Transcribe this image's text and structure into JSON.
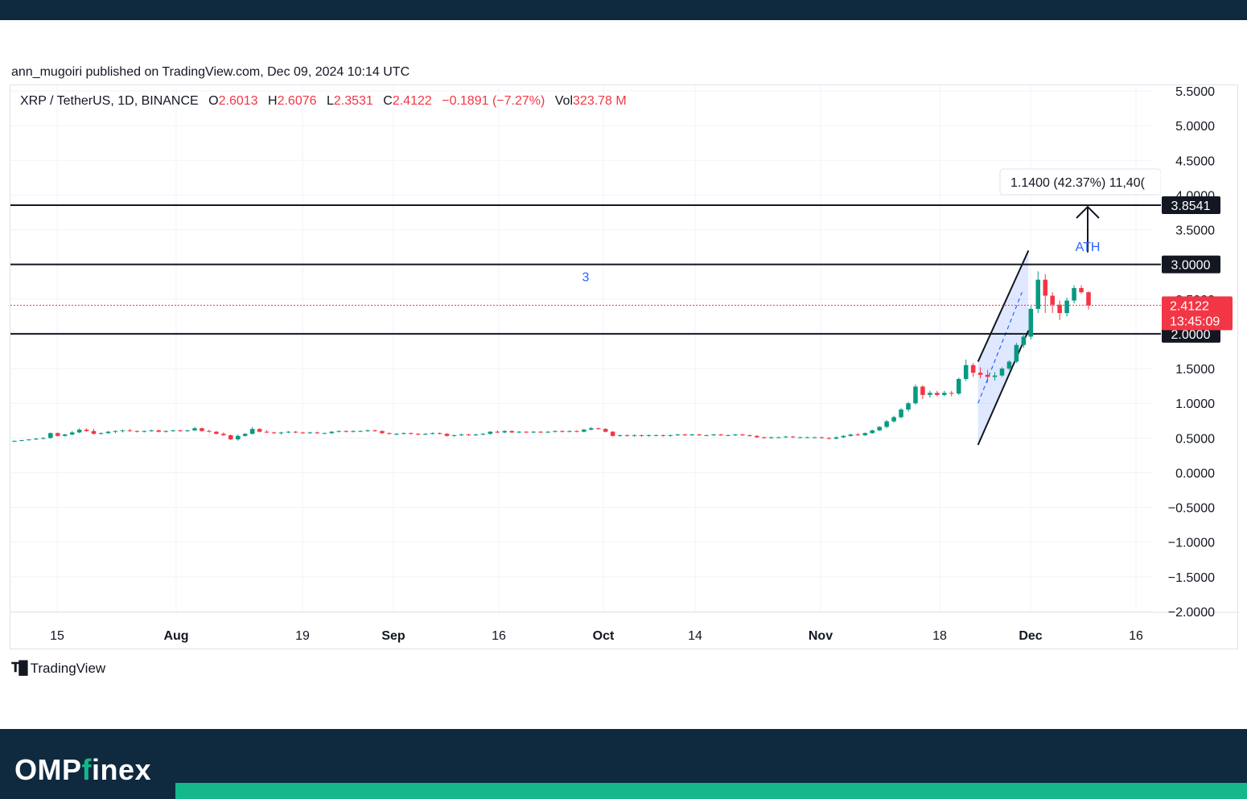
{
  "publisher": "ann_mugoiri published on TradingView.com, Dec 09, 2024 10:14 UTC",
  "legend": {
    "symbol": "XRP / TetherUS, 1D, BINANCE",
    "o_label": "O",
    "o": "2.6013",
    "h_label": "H",
    "h": "2.6076",
    "l_label": "L",
    "l": "2.3531",
    "c_label": "C",
    "c": "2.4122",
    "change": "−0.1891 (−7.27%)",
    "vol_label": "Vol",
    "vol": "323.78 M"
  },
  "branding": {
    "tv": "TradingView",
    "footer_brand_a": "OMP",
    "footer_brand_b": "f",
    "footer_brand_c": "inex"
  },
  "colors": {
    "up": "#089981",
    "down": "#f23645",
    "annotation": "#2962ff",
    "footer_bg": "#0f2a3f",
    "footer_accent": "#14b88a"
  },
  "chart_data": {
    "type": "candlestick",
    "x_ticks": [
      "15",
      "Aug",
      "19",
      "Sep",
      "16",
      "Oct",
      "14",
      "Nov",
      "18",
      "Dec",
      "16"
    ],
    "y_ticks": [
      "5.5000",
      "5.0000",
      "4.5000",
      "4.0000",
      "3.5000",
      "3.0000",
      "2.5000",
      "2.0000",
      "1.5000",
      "1.0000",
      "0.5000",
      "0.0000",
      "−0.5000",
      "−1.0000",
      "−1.5000",
      "−2.0000"
    ],
    "ylim": [
      -2.3,
      5.6
    ],
    "horizontal_levels": [
      {
        "value": 3.8541,
        "label": "3.8541"
      },
      {
        "value": 3.0,
        "label": "3.0000"
      },
      {
        "value": 2.0,
        "label": "2.0000"
      }
    ],
    "last_price": {
      "value": 2.4122,
      "label": "2.4122",
      "countdown": "13:45:09"
    },
    "measure": {
      "text": "1.1400 (42.37%) 11,40(",
      "from": 2.71,
      "to": 3.8541
    },
    "annotations": [
      {
        "text": "ATH",
        "price": 3.26
      },
      {
        "text": "3",
        "price": 2.83
      }
    ],
    "channel": {
      "lower": [
        0.4,
        2.05
      ],
      "upper": [
        1.6,
        3.2
      ]
    },
    "candles": [
      [
        0.45,
        0.46,
        0.44,
        0.46
      ],
      [
        0.46,
        0.47,
        0.45,
        0.47
      ],
      [
        0.47,
        0.48,
        0.46,
        0.48
      ],
      [
        0.48,
        0.5,
        0.47,
        0.49
      ],
      [
        0.49,
        0.51,
        0.48,
        0.5
      ],
      [
        0.5,
        0.58,
        0.49,
        0.57
      ],
      [
        0.57,
        0.58,
        0.52,
        0.53
      ],
      [
        0.53,
        0.56,
        0.52,
        0.55
      ],
      [
        0.55,
        0.6,
        0.54,
        0.58
      ],
      [
        0.58,
        0.64,
        0.57,
        0.62
      ],
      [
        0.62,
        0.64,
        0.59,
        0.6
      ],
      [
        0.6,
        0.63,
        0.55,
        0.56
      ],
      [
        0.56,
        0.58,
        0.55,
        0.57
      ],
      [
        0.57,
        0.6,
        0.56,
        0.59
      ],
      [
        0.59,
        0.61,
        0.57,
        0.6
      ],
      [
        0.6,
        0.62,
        0.58,
        0.61
      ],
      [
        0.61,
        0.63,
        0.59,
        0.6
      ],
      [
        0.6,
        0.61,
        0.58,
        0.59
      ],
      [
        0.59,
        0.61,
        0.58,
        0.6
      ],
      [
        0.6,
        0.62,
        0.59,
        0.61
      ],
      [
        0.61,
        0.62,
        0.58,
        0.59
      ],
      [
        0.59,
        0.61,
        0.58,
        0.6
      ],
      [
        0.6,
        0.62,
        0.59,
        0.61
      ],
      [
        0.61,
        0.62,
        0.59,
        0.6
      ],
      [
        0.6,
        0.62,
        0.59,
        0.61
      ],
      [
        0.61,
        0.66,
        0.6,
        0.64
      ],
      [
        0.64,
        0.65,
        0.59,
        0.6
      ],
      [
        0.6,
        0.62,
        0.58,
        0.59
      ],
      [
        0.59,
        0.6,
        0.55,
        0.56
      ],
      [
        0.56,
        0.58,
        0.53,
        0.54
      ],
      [
        0.54,
        0.55,
        0.47,
        0.48
      ],
      [
        0.48,
        0.55,
        0.46,
        0.53
      ],
      [
        0.53,
        0.57,
        0.52,
        0.56
      ],
      [
        0.56,
        0.66,
        0.55,
        0.63
      ],
      [
        0.63,
        0.64,
        0.58,
        0.59
      ],
      [
        0.59,
        0.61,
        0.57,
        0.58
      ],
      [
        0.58,
        0.59,
        0.56,
        0.57
      ],
      [
        0.57,
        0.59,
        0.55,
        0.58
      ],
      [
        0.58,
        0.6,
        0.57,
        0.59
      ],
      [
        0.59,
        0.6,
        0.57,
        0.58
      ],
      [
        0.58,
        0.59,
        0.56,
        0.57
      ],
      [
        0.57,
        0.59,
        0.56,
        0.58
      ],
      [
        0.58,
        0.59,
        0.56,
        0.57
      ],
      [
        0.57,
        0.58,
        0.56,
        0.57
      ],
      [
        0.57,
        0.6,
        0.56,
        0.59
      ],
      [
        0.59,
        0.61,
        0.58,
        0.6
      ],
      [
        0.6,
        0.61,
        0.58,
        0.59
      ],
      [
        0.59,
        0.61,
        0.58,
        0.6
      ],
      [
        0.6,
        0.61,
        0.59,
        0.6
      ],
      [
        0.6,
        0.62,
        0.59,
        0.61
      ],
      [
        0.61,
        0.62,
        0.59,
        0.6
      ],
      [
        0.6,
        0.61,
        0.56,
        0.57
      ],
      [
        0.57,
        0.58,
        0.55,
        0.56
      ],
      [
        0.56,
        0.57,
        0.54,
        0.56
      ],
      [
        0.56,
        0.58,
        0.55,
        0.57
      ],
      [
        0.57,
        0.58,
        0.55,
        0.56
      ],
      [
        0.56,
        0.57,
        0.54,
        0.55
      ],
      [
        0.55,
        0.57,
        0.54,
        0.56
      ],
      [
        0.56,
        0.58,
        0.55,
        0.57
      ],
      [
        0.57,
        0.58,
        0.55,
        0.56
      ],
      [
        0.56,
        0.57,
        0.52,
        0.53
      ],
      [
        0.53,
        0.55,
        0.52,
        0.54
      ],
      [
        0.54,
        0.56,
        0.53,
        0.55
      ],
      [
        0.55,
        0.56,
        0.53,
        0.54
      ],
      [
        0.54,
        0.56,
        0.53,
        0.55
      ],
      [
        0.55,
        0.57,
        0.54,
        0.56
      ],
      [
        0.56,
        0.6,
        0.55,
        0.59
      ],
      [
        0.59,
        0.61,
        0.57,
        0.58
      ],
      [
        0.58,
        0.61,
        0.57,
        0.6
      ],
      [
        0.6,
        0.61,
        0.57,
        0.58
      ],
      [
        0.58,
        0.6,
        0.57,
        0.59
      ],
      [
        0.59,
        0.6,
        0.57,
        0.58
      ],
      [
        0.58,
        0.6,
        0.57,
        0.59
      ],
      [
        0.59,
        0.6,
        0.57,
        0.58
      ],
      [
        0.58,
        0.6,
        0.57,
        0.59
      ],
      [
        0.59,
        0.61,
        0.58,
        0.6
      ],
      [
        0.6,
        0.61,
        0.58,
        0.59
      ],
      [
        0.59,
        0.61,
        0.58,
        0.6
      ],
      [
        0.6,
        0.61,
        0.58,
        0.59
      ],
      [
        0.59,
        0.63,
        0.58,
        0.62
      ],
      [
        0.62,
        0.66,
        0.61,
        0.64
      ],
      [
        0.64,
        0.65,
        0.62,
        0.63
      ],
      [
        0.63,
        0.64,
        0.58,
        0.59
      ],
      [
        0.59,
        0.6,
        0.52,
        0.53
      ],
      [
        0.53,
        0.55,
        0.52,
        0.54
      ],
      [
        0.54,
        0.55,
        0.52,
        0.53
      ],
      [
        0.53,
        0.55,
        0.52,
        0.54
      ],
      [
        0.54,
        0.55,
        0.52,
        0.53
      ],
      [
        0.53,
        0.55,
        0.52,
        0.54
      ],
      [
        0.54,
        0.55,
        0.53,
        0.54
      ],
      [
        0.54,
        0.55,
        0.52,
        0.53
      ],
      [
        0.53,
        0.55,
        0.52,
        0.54
      ],
      [
        0.54,
        0.56,
        0.53,
        0.55
      ],
      [
        0.55,
        0.56,
        0.53,
        0.54
      ],
      [
        0.54,
        0.56,
        0.53,
        0.55
      ],
      [
        0.55,
        0.56,
        0.53,
        0.54
      ],
      [
        0.54,
        0.55,
        0.53,
        0.54
      ],
      [
        0.54,
        0.56,
        0.53,
        0.55
      ],
      [
        0.55,
        0.56,
        0.53,
        0.54
      ],
      [
        0.54,
        0.55,
        0.53,
        0.54
      ],
      [
        0.54,
        0.56,
        0.53,
        0.55
      ],
      [
        0.55,
        0.56,
        0.53,
        0.54
      ],
      [
        0.54,
        0.55,
        0.52,
        0.53
      ],
      [
        0.53,
        0.54,
        0.5,
        0.51
      ],
      [
        0.51,
        0.52,
        0.49,
        0.5
      ],
      [
        0.5,
        0.52,
        0.49,
        0.51
      ],
      [
        0.51,
        0.52,
        0.5,
        0.51
      ],
      [
        0.51,
        0.53,
        0.5,
        0.52
      ],
      [
        0.52,
        0.53,
        0.5,
        0.51
      ],
      [
        0.51,
        0.52,
        0.5,
        0.51
      ],
      [
        0.51,
        0.52,
        0.5,
        0.51
      ],
      [
        0.51,
        0.52,
        0.5,
        0.51
      ],
      [
        0.51,
        0.52,
        0.49,
        0.5
      ],
      [
        0.5,
        0.51,
        0.48,
        0.49
      ],
      [
        0.49,
        0.52,
        0.48,
        0.51
      ],
      [
        0.51,
        0.54,
        0.5,
        0.53
      ],
      [
        0.53,
        0.56,
        0.52,
        0.55
      ],
      [
        0.55,
        0.57,
        0.53,
        0.54
      ],
      [
        0.54,
        0.58,
        0.53,
        0.57
      ],
      [
        0.57,
        0.62,
        0.56,
        0.61
      ],
      [
        0.61,
        0.67,
        0.6,
        0.66
      ],
      [
        0.66,
        0.76,
        0.64,
        0.74
      ],
      [
        0.74,
        0.82,
        0.72,
        0.8
      ],
      [
        0.8,
        0.93,
        0.78,
        0.91
      ],
      [
        0.91,
        1.02,
        0.88,
        1.0
      ],
      [
        1.0,
        1.27,
        0.98,
        1.24
      ],
      [
        1.24,
        1.26,
        1.06,
        1.12
      ],
      [
        1.12,
        1.18,
        1.08,
        1.15
      ],
      [
        1.15,
        1.18,
        1.1,
        1.12
      ],
      [
        1.12,
        1.18,
        1.1,
        1.15
      ],
      [
        1.15,
        1.18,
        1.1,
        1.14
      ],
      [
        1.14,
        1.37,
        1.12,
        1.35
      ],
      [
        1.35,
        1.63,
        1.32,
        1.55
      ],
      [
        1.55,
        1.58,
        1.38,
        1.44
      ],
      [
        1.44,
        1.52,
        1.36,
        1.41
      ],
      [
        1.41,
        1.48,
        1.3,
        1.38
      ],
      [
        1.38,
        1.45,
        1.33,
        1.4
      ],
      [
        1.4,
        1.52,
        1.38,
        1.5
      ],
      [
        1.5,
        1.62,
        1.48,
        1.6
      ],
      [
        1.6,
        1.87,
        1.58,
        1.84
      ],
      [
        1.84,
        2.0,
        1.8,
        1.96
      ],
      [
        1.96,
        2.4,
        1.92,
        2.36
      ],
      [
        2.36,
        2.9,
        2.3,
        2.78
      ],
      [
        2.78,
        2.86,
        2.3,
        2.55
      ],
      [
        2.55,
        2.6,
        2.3,
        2.42
      ],
      [
        2.42,
        2.48,
        2.2,
        2.3
      ],
      [
        2.3,
        2.52,
        2.25,
        2.48
      ],
      [
        2.48,
        2.7,
        2.44,
        2.66
      ],
      [
        2.66,
        2.7,
        2.58,
        2.6
      ],
      [
        2.6,
        2.61,
        2.35,
        2.41
      ]
    ]
  }
}
